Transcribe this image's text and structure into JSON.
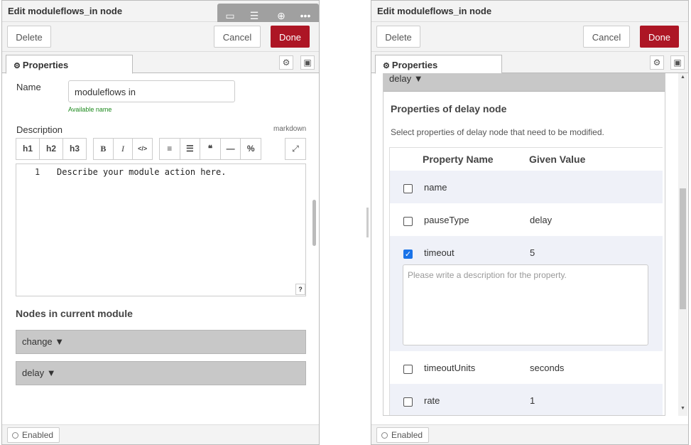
{
  "left": {
    "title": "Edit moduleflows_in node",
    "delete_label": "Delete",
    "cancel_label": "Cancel",
    "done_label": "Done",
    "tab_label": "Properties",
    "name_label": "Name",
    "name_value": "moduleflows in",
    "name_hint": "Available name",
    "description_label": "Description",
    "markdown_label": "markdown",
    "toolbar": [
      "h1",
      "h2",
      "h3",
      "B",
      "I",
      "</>",
      "≡",
      "☰",
      "❝",
      "—",
      "%"
    ],
    "editor_line_number": "1",
    "editor_text": "Describe your module action here.",
    "help_label": "?",
    "nodes_heading": "Nodes in current module",
    "node_items": [
      "change ▼",
      "delay ▼"
    ],
    "enabled_label": "Enabled",
    "floating_toolbar_icons": [
      "comment-icon",
      "list-icon",
      "download-icon",
      "more-icon"
    ]
  },
  "right": {
    "title": "Edit moduleflows_in node",
    "delete_label": "Delete",
    "cancel_label": "Cancel",
    "done_label": "Done",
    "tab_label": "Properties",
    "delay_header": "delay ▼",
    "section_title": "Properties of delay node",
    "section_subtitle": "Select properties of delay node that need to be modified.",
    "col_name": "Property Name",
    "col_value": "Given Value",
    "rows": [
      {
        "name": "name",
        "value": "",
        "checked": false
      },
      {
        "name": "pauseType",
        "value": "delay",
        "checked": false
      },
      {
        "name": "timeout",
        "value": "5",
        "checked": true
      },
      {
        "name": "timeoutUnits",
        "value": "seconds",
        "checked": false
      },
      {
        "name": "rate",
        "value": "1",
        "checked": false
      }
    ],
    "description_placeholder": "Please write a description for the property.",
    "enabled_label": "Enabled"
  },
  "colors": {
    "done": "#ad1625",
    "checkbox": "#1a73e8",
    "row_alt": "#eff1f8",
    "gray_bar": "#c8c8c8"
  }
}
